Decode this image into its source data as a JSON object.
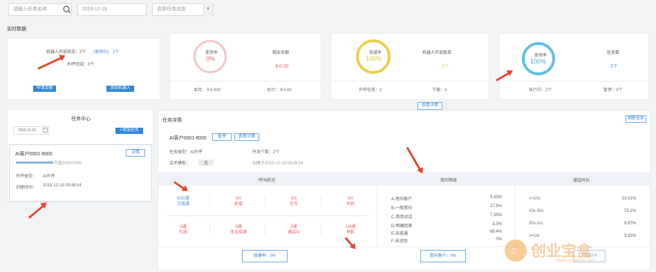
{
  "search": {
    "placeholder": "请输入任务名称",
    "date": "2019-12-19",
    "status": "选择任务状态"
  },
  "section_title": "实时数据",
  "robot": {
    "status": "机器人开放状态：2个",
    "link": "(使用中)",
    "count": "2个",
    "dial": "外呼完成：0个",
    "btn1": "申请余额",
    "btn2": "添加机器人"
  },
  "gauge1": {
    "label": "使用率",
    "value": "0%",
    "cost_label": "剩余余额",
    "cost": "￥0.00",
    "used": "本月：￥0.000",
    "total": "总计：￥0.00"
  },
  "gauge2": {
    "label": "接通率",
    "value": "100%",
    "title": "机器人开放数目",
    "num": "2个",
    "left": "外呼任务：2",
    "right": "下拨：0"
  },
  "gauge3": {
    "label": "使用率",
    "value": "100%",
    "title": "任务数",
    "num": "2个",
    "left": "执行中：2个",
    "right": "暂停：0个"
  },
  "more_btn": "查看详情",
  "task_center": {
    "title": "任务中心",
    "date": "2019-12-19",
    "add_btn": "+添加任务",
    "task_name": "AI客户0001  8000",
    "task_btn": "详情",
    "progress": "开发2000/2000",
    "type_label": "外呼类型：",
    "type_val": "AI外呼",
    "time_label": "创建时间：",
    "time_val": "2019-12-19  09:48:04"
  },
  "detail": {
    "title": "任务详情",
    "btn": "刷新任务",
    "task": "AI客户0001  8000",
    "b1": "暂停",
    "b2": "查看详情",
    "kind": "任务类型：AI外呼",
    "dev": "开发个数：2个",
    "line": "话术模板：",
    "line_val": "无",
    "created": "创建于2019-12-19 09:48:04"
  },
  "tabs": {
    "t1": "呼叫状况",
    "t2": "意向等级",
    "t3": "通话时长"
  },
  "call_cells": [
    {
      "num": "0/32通",
      "label": "已接通",
      "cls": "blue"
    },
    {
      "num": "0/0",
      "label": "拒接",
      "cls": "red"
    },
    {
      "num": "0/0",
      "label": "空号",
      "cls": "red"
    },
    {
      "num": "0/0",
      "label": "关机",
      "cls": "red"
    },
    {
      "num": "0通",
      "label": "忙线",
      "cls": "red"
    },
    {
      "num": "0通",
      "label": "无法接通",
      "cls": "red"
    },
    {
      "num": "0通",
      "label": "通话中",
      "cls": "red"
    },
    {
      "num": "1/4通",
      "label": "停机",
      "cls": "red"
    }
  ],
  "intent": [
    {
      "l": "A-意向客户",
      "r": "3.43%"
    },
    {
      "l": "B-一般意向",
      "r": "17.5%"
    },
    {
      "l": "C-简单对话",
      "r": "7.35%"
    },
    {
      "l": "D-明确拒绝",
      "r": "3.3%"
    },
    {
      "l": "E-未接通",
      "r": "68.4%"
    },
    {
      "l": "F-未识别",
      "r": "0%"
    }
  ],
  "duration": [
    {
      "l": "<=10s",
      "r": "13.01%"
    },
    {
      "l": "10s-30s",
      "r": "73.1%"
    },
    {
      "l": "30s-1m",
      "r": "9.97%"
    },
    {
      "l": ">=1m",
      "r": "3.32%"
    }
  ],
  "bottom": {
    "b1": "接通率：0%",
    "b2": "意向客户：0%",
    "b3": "平均时长"
  },
  "watermark": {
    "text": "创业宝盒",
    "url": "www.cybaohe.com"
  },
  "colors": {
    "accent": "#2f86d8",
    "ring_red": "#f2c6c6",
    "ring_yellow": "#e8d04a",
    "ring_blue": "#5fc1e0",
    "arrow": "#e8452e"
  }
}
